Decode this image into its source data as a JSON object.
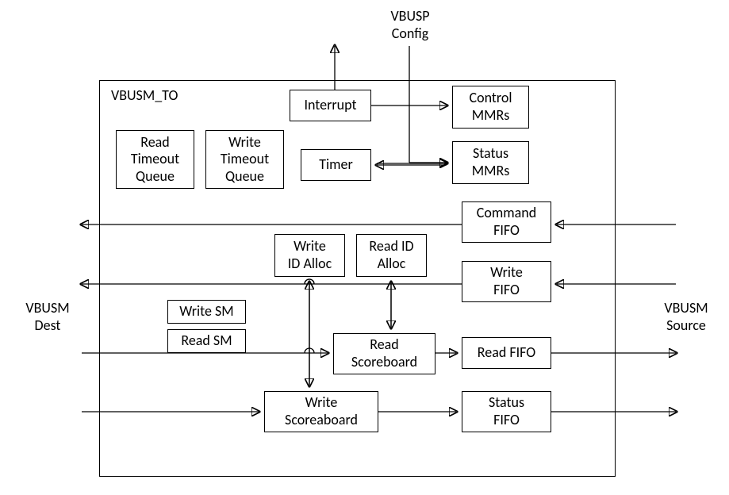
{
  "labels": {
    "title": "VBUSM_TO",
    "vbusp_config": "VBUSP\nConfig",
    "vbusm_dest": "VBUSM\nDest",
    "vbusm_source": "VBUSM\nSource"
  },
  "blocks": {
    "interrupt": "Interrupt",
    "timer": "Timer",
    "control_mmrs": "Control\nMMRs",
    "status_mmrs": "Status\nMMRs",
    "read_timeout_queue": "Read\nTimeout\nQueue",
    "write_timeout_queue": "Write\nTimeout\nQueue",
    "command_fifo": "Command\nFIFO",
    "write_id_alloc": "Write\nID Alloc",
    "read_id_alloc": "Read ID\nAlloc",
    "write_fifo": "Write\nFIFO",
    "write_sm": "Write SM",
    "read_sm": "Read SM",
    "read_scoreboard": "Read\nScoreboard",
    "read_fifo": "Read FIFO",
    "write_scoreaboard": "Write\nScoreaboard",
    "status_fifo": "Status\nFIFO"
  }
}
